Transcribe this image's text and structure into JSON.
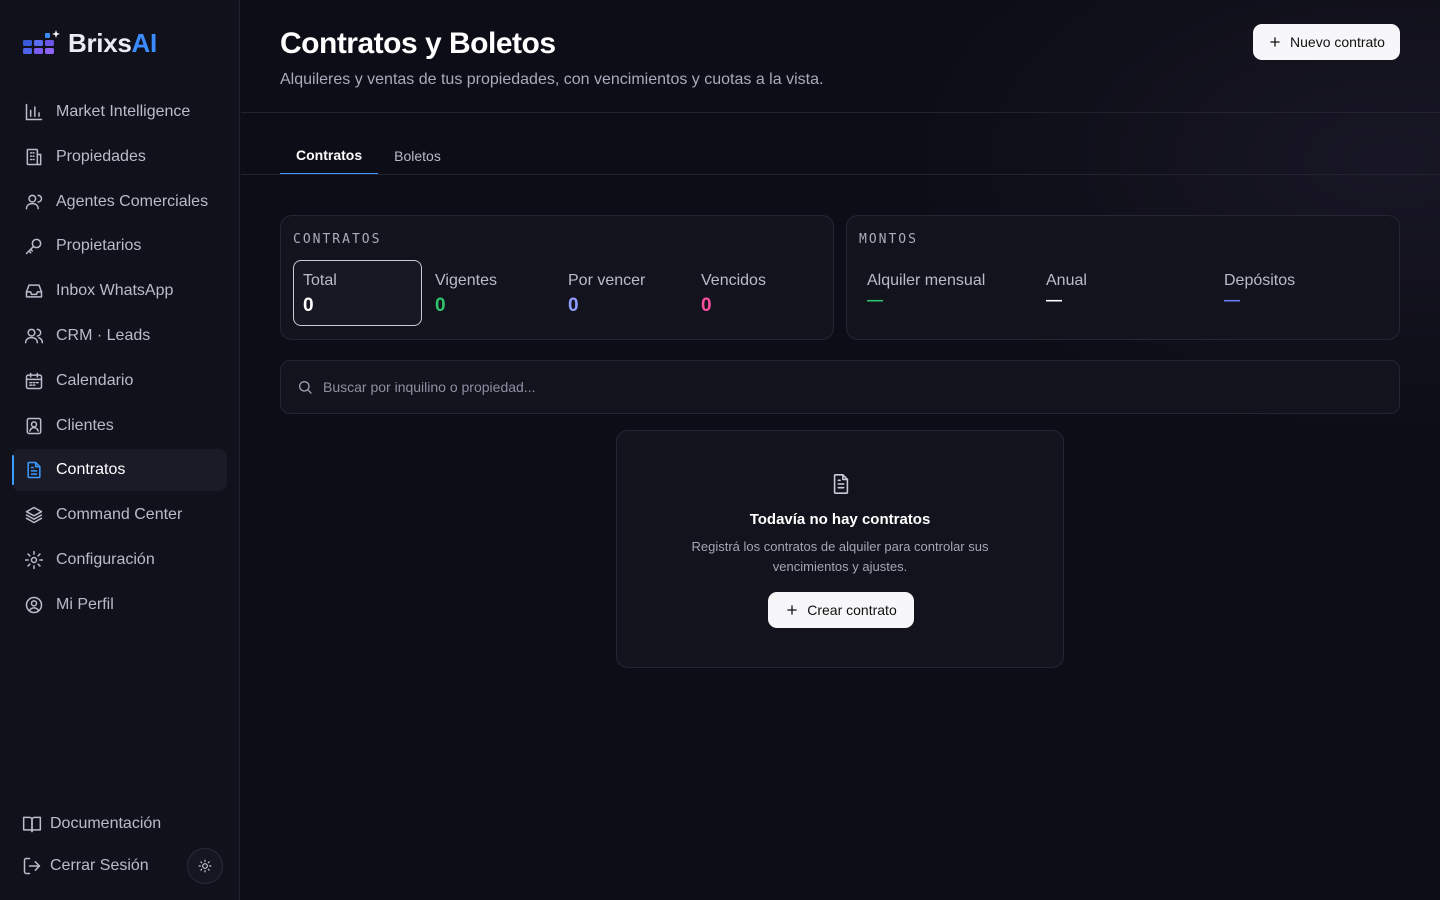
{
  "brand": {
    "name_main": "Brixs",
    "name_accent": "AI",
    "accent_color": "#3b8cff"
  },
  "sidebar": {
    "items": [
      {
        "label": "Market Intelligence",
        "icon": "bar-chart-icon"
      },
      {
        "label": "Propiedades",
        "icon": "building-icon"
      },
      {
        "label": "Agentes Comerciales",
        "icon": "user-icon"
      },
      {
        "label": "Propietarios",
        "icon": "key-icon"
      },
      {
        "label": "Inbox WhatsApp",
        "icon": "inbox-icon"
      },
      {
        "label": "CRM · Leads",
        "icon": "users-icon"
      },
      {
        "label": "Calendario",
        "icon": "calendar-icon"
      },
      {
        "label": "Clientes",
        "icon": "contact-icon"
      },
      {
        "label": "Contratos",
        "icon": "document-icon",
        "active": true
      },
      {
        "label": "Command Center",
        "icon": "layers-icon"
      },
      {
        "label": "Configuración",
        "icon": "gear-icon"
      },
      {
        "label": "Mi Perfil",
        "icon": "user-circle-icon"
      }
    ],
    "docs_label": "Documentación",
    "logout_label": "Cerrar Sesión"
  },
  "header": {
    "title": "Contratos y Boletos",
    "subtitle": "Alquileres y ventas de tus propiedades, con vencimientos y cuotas a la vista.",
    "new_button": "Nuevo contrato"
  },
  "tabs": [
    {
      "label": "Contratos",
      "active": true
    },
    {
      "label": "Boletos",
      "active": false
    }
  ],
  "contracts_card": {
    "caption": "CONTRATOS",
    "stats": [
      {
        "label": "Total",
        "value": "0",
        "color": "#ffffff"
      },
      {
        "label": "Vigentes",
        "value": "0",
        "color": "#2ec46d"
      },
      {
        "label": "Por vencer",
        "value": "0",
        "color": "#8f9bff"
      },
      {
        "label": "Vencidos",
        "value": "0",
        "color": "#ff4fa0"
      }
    ]
  },
  "amounts_card": {
    "caption": "MONTOS",
    "items": [
      {
        "label": "Alquiler mensual",
        "value": "—",
        "color": "#2ec46d"
      },
      {
        "label": "Anual",
        "value": "—",
        "color": "#ffffff"
      },
      {
        "label": "Depósitos",
        "value": "—",
        "color": "#6f7bff"
      }
    ]
  },
  "search": {
    "placeholder": "Buscar por inquilino o propiedad..."
  },
  "empty_state": {
    "title": "Todavía no hay contratos",
    "description": "Registrá los contratos de alquiler para controlar sus vencimientos y ajustes.",
    "button": "Crear contrato"
  }
}
